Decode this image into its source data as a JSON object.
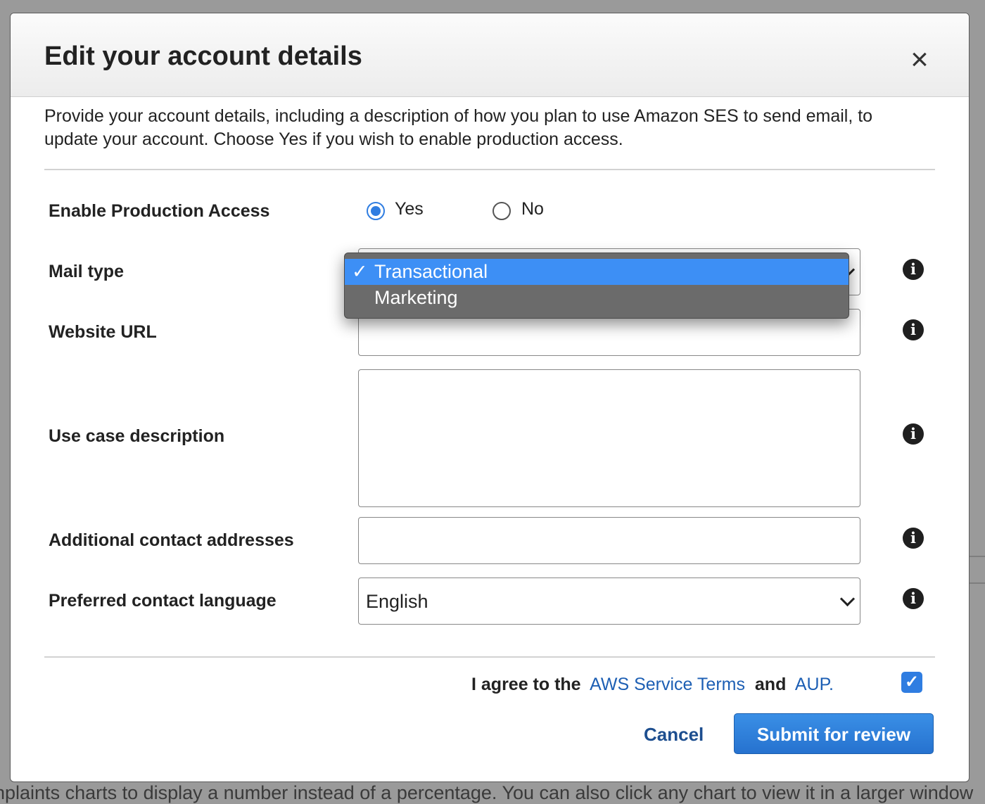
{
  "background": {
    "bottom_text": "nplaints charts to display a number instead of a percentage. You can also click any chart to view it in a larger window"
  },
  "modal": {
    "title": "Edit your account details",
    "close_icon": "close-icon",
    "intro": "Provide your account details, including a description of how you plan to use Amazon SES to send email, to update your account. Choose Yes if you wish to enable production access.",
    "production_access": {
      "label": "Enable Production Access",
      "options": [
        "Yes",
        "No"
      ],
      "selected": "Yes"
    },
    "mail_type": {
      "label": "Mail type",
      "options": [
        "Transactional",
        "Marketing"
      ],
      "selected": "Transactional",
      "check_glyph": "✓"
    },
    "website_url": {
      "label": "Website URL",
      "value": ""
    },
    "use_case": {
      "label": "Use case description",
      "value": ""
    },
    "additional_contacts": {
      "label": "Additional contact addresses",
      "value": ""
    },
    "contact_language": {
      "label": "Preferred contact language",
      "value": "English"
    },
    "agreement": {
      "prefix": "I agree to the",
      "terms_link": "AWS Service Terms",
      "joiner": "and",
      "aup_link": "AUP.",
      "checked": true,
      "check_glyph": "✓"
    },
    "cancel_label": "Cancel",
    "submit_label": "Submit for review",
    "info_glyph": "i"
  }
}
